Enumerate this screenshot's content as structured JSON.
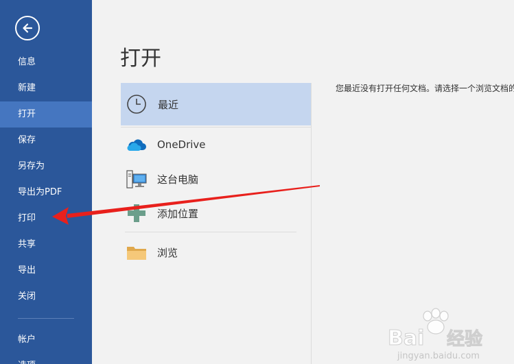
{
  "sidebar": {
    "nav_top": [
      {
        "label": "信息"
      },
      {
        "label": "新建"
      },
      {
        "label": "打开"
      },
      {
        "label": "保存"
      },
      {
        "label": "另存为"
      },
      {
        "label": "导出为PDF"
      },
      {
        "label": "打印"
      },
      {
        "label": "共享"
      },
      {
        "label": "导出"
      },
      {
        "label": "关闭"
      }
    ],
    "nav_bottom": [
      {
        "label": "帐户"
      },
      {
        "label": "选项"
      }
    ],
    "active": "打开"
  },
  "main": {
    "title": "打开",
    "locations": [
      {
        "label": "最近",
        "icon": "clock-icon"
      },
      {
        "label": "OneDrive",
        "icon": "cloud-icon"
      },
      {
        "label": "这台电脑",
        "icon": "computer-icon"
      },
      {
        "label": "添加位置",
        "icon": "plus-icon"
      },
      {
        "label": "浏览",
        "icon": "folder-icon"
      }
    ],
    "empty_message": "您最近没有打开任何文档。请选择一个浏览文档的位置"
  },
  "colors": {
    "sidebar": "#2b579a",
    "active_nav": "#4576c0",
    "selected_location": "#c5d6ef",
    "annotation_arrow": "#e8201c"
  },
  "watermark": {
    "text": "Bai经验",
    "subtext": "jingyan.baidu.com"
  }
}
